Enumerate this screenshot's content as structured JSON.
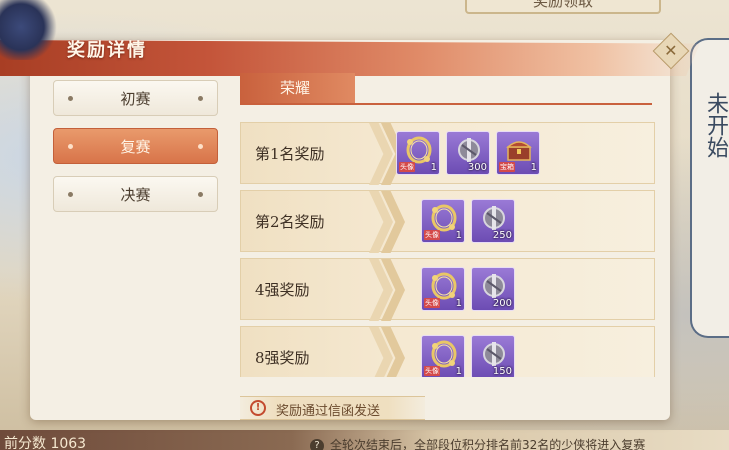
{
  "background": {
    "top_button": "奖励领取",
    "right_panel_text": "未开始",
    "score_text": "前分数 1063",
    "note_text": "全轮次结束后，全部段位积分排名前32名的少侠将进入复赛"
  },
  "dialog": {
    "title": "奖励详情",
    "close_icon": "close-icon"
  },
  "sidebar": {
    "items": [
      {
        "label": "初赛",
        "active": false
      },
      {
        "label": "复赛",
        "active": true
      },
      {
        "label": "决赛",
        "active": false
      }
    ]
  },
  "content": {
    "tab_label": "荣耀",
    "rows": [
      {
        "label": "第1名奖励",
        "items": [
          {
            "icon": "golden-frame-icon",
            "tag": "头像",
            "qty": "1"
          },
          {
            "icon": "silver-token-icon",
            "tag": "",
            "qty": "300"
          },
          {
            "icon": "treasure-chest-icon",
            "tag": "宝箱",
            "qty": "1"
          }
        ]
      },
      {
        "label": "第2名奖励",
        "items": [
          {
            "icon": "golden-frame-icon",
            "tag": "头像",
            "qty": "1"
          },
          {
            "icon": "silver-token-icon",
            "tag": "",
            "qty": "250"
          }
        ]
      },
      {
        "label": "4强奖励",
        "items": [
          {
            "icon": "golden-frame-icon",
            "tag": "头像",
            "qty": "1"
          },
          {
            "icon": "silver-token-icon",
            "tag": "",
            "qty": "200"
          }
        ]
      },
      {
        "label": "8强奖励",
        "items": [
          {
            "icon": "golden-frame-icon",
            "tag": "头像",
            "qty": "1"
          },
          {
            "icon": "silver-token-icon",
            "tag": "",
            "qty": "150"
          }
        ]
      }
    ]
  },
  "footer": {
    "notice": "奖励通过信函发送",
    "notice_icon": "exclamation-icon"
  },
  "colors": {
    "accent": "#d8744a",
    "title_band": "#c4553a",
    "item_purple": "#7a5ac4"
  }
}
